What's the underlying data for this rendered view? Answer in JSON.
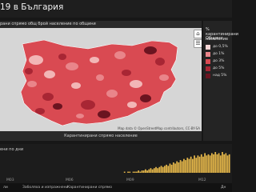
{
  "header": {
    "title": "19 в България"
  },
  "map": {
    "subtitle": "рани спрямо общ брой население по общини",
    "attribution": "Map data © OpenStreetMap contributors, CC-BY-SA",
    "footer": "Карантинирани спрямо население",
    "tools": {
      "home": "⌂",
      "layers": "☰"
    },
    "region_colors": {
      "base": "#d94a52",
      "light": "#e9858a",
      "lighter": "#f2b6b6",
      "dark": "#a82634",
      "darkest": "#6b1420"
    }
  },
  "legend": {
    "title": "% карантинирани население",
    "subtitle": "Общини",
    "items": [
      {
        "label": "до 0,5%",
        "color": "#f7d6d6"
      },
      {
        "label": "до 1%",
        "color": "#e9858a"
      },
      {
        "label": "до 3%",
        "color": "#d94a52"
      },
      {
        "label": "до 5%",
        "color": "#a82634"
      },
      {
        "label": "над 5%",
        "color": "#6b1420"
      }
    ]
  },
  "chart": {
    "title": "ени по дни",
    "x_ticks": [
      "M03",
      "M06",
      "M09",
      "M12"
    ],
    "series": [
      {
        "color": "#e6b84a",
        "values": [
          0,
          0,
          0,
          0,
          0,
          0,
          0,
          0,
          0,
          0,
          0,
          0,
          0,
          0,
          0,
          0,
          0,
          0,
          0,
          0,
          0,
          0,
          0,
          0,
          0,
          0,
          0,
          0,
          0,
          0,
          0,
          0,
          0,
          0,
          0,
          0,
          0,
          0,
          0,
          0,
          0,
          0,
          0,
          0,
          0,
          0,
          0,
          0,
          0,
          0,
          0,
          0,
          0,
          0,
          0,
          0,
          0,
          0,
          0,
          0,
          0,
          0,
          0,
          0,
          0,
          0,
          0,
          0,
          0,
          0,
          1,
          0,
          1,
          1,
          0,
          1,
          1,
          1,
          2,
          1,
          2,
          2,
          3,
          2,
          3,
          4,
          3,
          4,
          5,
          4,
          5,
          6,
          5,
          6,
          7,
          6,
          8,
          7,
          9,
          8,
          10,
          9,
          11,
          10,
          12,
          11,
          13,
          12,
          14,
          12,
          15,
          13,
          15,
          14,
          16,
          14,
          17,
          15,
          16,
          15,
          17,
          16,
          18,
          16,
          17,
          15,
          18,
          16,
          17,
          15,
          16
        ]
      }
    ]
  },
  "tabs": [
    {
      "label": "ли",
      "active": false
    },
    {
      "label": "Заболяха и изпражнени",
      "active": false
    },
    {
      "label": "Карантинирани спрямо",
      "active": false
    },
    {
      "label": "Дн",
      "active": false
    }
  ]
}
